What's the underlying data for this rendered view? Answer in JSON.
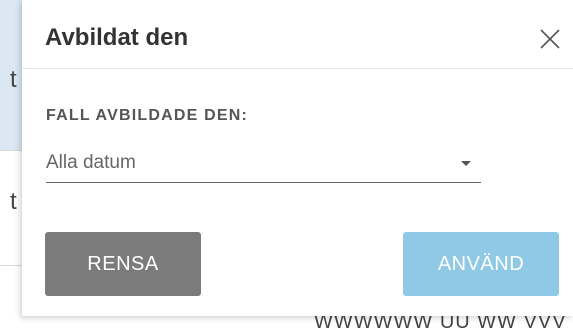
{
  "background": {
    "row_fragments": [
      "t",
      "t"
    ],
    "bottom_text_fragment": "WWWWWW UU WW VVV"
  },
  "popup": {
    "title": "Avbildat den",
    "close_icon": "close-x-icon",
    "field_label": "FALL AVBILDADE DEN:",
    "date_select": {
      "selected": "Alla datum"
    },
    "buttons": {
      "clear_label": "RENSA",
      "apply_label": "ANVÄND"
    }
  },
  "colors": {
    "clear_button": "#7b7b7b",
    "apply_button": "#8fc9e6",
    "title_text": "#333333",
    "highlight_row": "#dbe7f2"
  }
}
